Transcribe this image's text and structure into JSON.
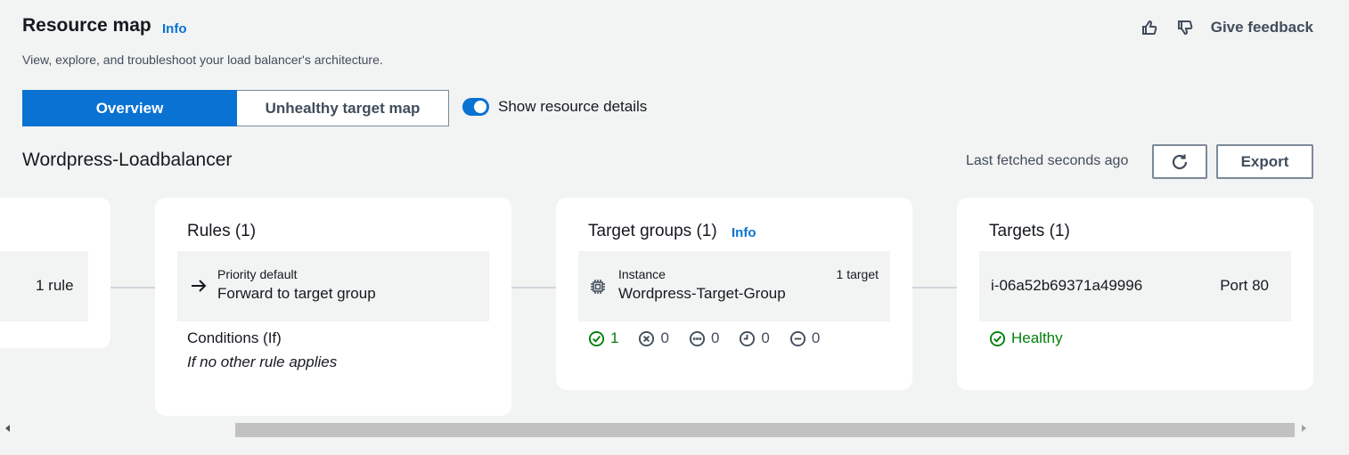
{
  "header": {
    "title": "Resource map",
    "info": "Info",
    "subtitle": "View, explore, and troubleshoot your load balancer's architecture.",
    "feedback_label": "Give feedback"
  },
  "tabs": [
    {
      "label": "Overview",
      "selected": true
    },
    {
      "label": "Unhealthy target map",
      "selected": false
    }
  ],
  "toggle": {
    "label": "Show resource details",
    "checked": true
  },
  "loadbalancer": {
    "name": "Wordpress-Loadbalancer",
    "last_fetched": "Last fetched seconds ago",
    "export_label": "Export"
  },
  "listeners_card": {
    "rule_count": "1 rule"
  },
  "rules_card": {
    "title": "Rules (1)",
    "priority": "Priority default",
    "action": "Forward to target group",
    "conditions_label": "Conditions (If)",
    "conditions_value": "If no other rule applies"
  },
  "target_groups_card": {
    "title": "Target groups (1)",
    "info": "Info",
    "type": "Instance",
    "name": "Wordpress-Target-Group",
    "target_count": "1 target",
    "status_counts": {
      "healthy": "1",
      "unhealthy": "0",
      "unused": "0",
      "draining": "0",
      "unavailable": "0"
    }
  },
  "targets_card": {
    "title": "Targets (1)",
    "instance_id": "i-06a52b69371a49996",
    "port": "Port 80",
    "health": "Healthy"
  },
  "colors": {
    "primary": "#0972d3",
    "healthy": "#037f0c",
    "background": "#f2f3f3"
  }
}
